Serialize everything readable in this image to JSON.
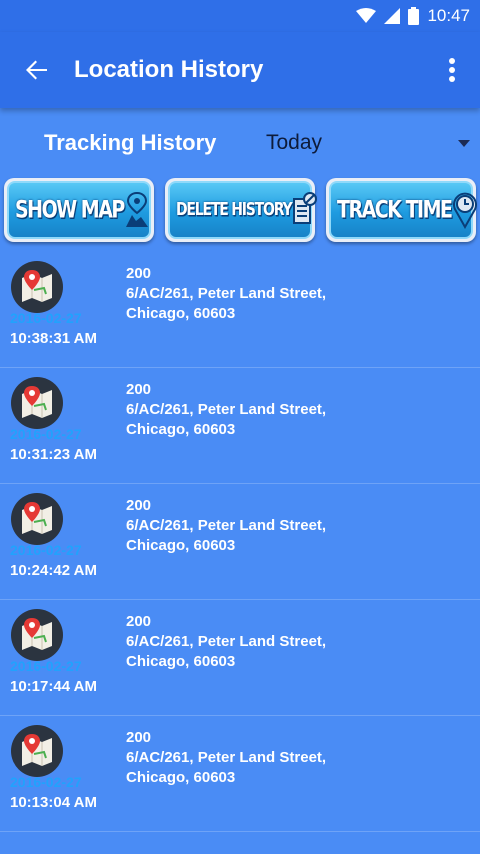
{
  "status_bar": {
    "time": "10:47"
  },
  "app_bar": {
    "title": "Location History"
  },
  "filter": {
    "label": "Tracking History",
    "value": "Today"
  },
  "buttons": {
    "show_map": "SHOW MAP",
    "delete_history": "DELETE HISTORY",
    "track_time": "TRACK TIME"
  },
  "entries": [
    {
      "date": "2016-02-27",
      "time": "10:38:31 AM",
      "code": "200",
      "address_line1": "6/AC/261, Peter Land Street,",
      "address_line2": "Chicago, 60603"
    },
    {
      "date": "2016-02-27",
      "time": "10:31:23 AM",
      "code": "200",
      "address_line1": "6/AC/261, Peter Land Street,",
      "address_line2": "Chicago, 60603"
    },
    {
      "date": "2016-02-27",
      "time": "10:24:42 AM",
      "code": "200",
      "address_line1": "6/AC/261, Peter Land Street,",
      "address_line2": "Chicago, 60603"
    },
    {
      "date": "2016-02-27",
      "time": "10:17:44 AM",
      "code": "200",
      "address_line1": "6/AC/261, Peter Land Street,",
      "address_line2": "Chicago, 60603"
    },
    {
      "date": "2016-02-27",
      "time": "10:13:04 AM",
      "code": "200",
      "address_line1": "6/AC/261, Peter Land Street,",
      "address_line2": "Chicago, 60603"
    }
  ],
  "colors": {
    "primary": "#2f6fe8",
    "background": "#4a8cf5",
    "button": "#1e9be0",
    "date_text": "#1aa7ff"
  }
}
